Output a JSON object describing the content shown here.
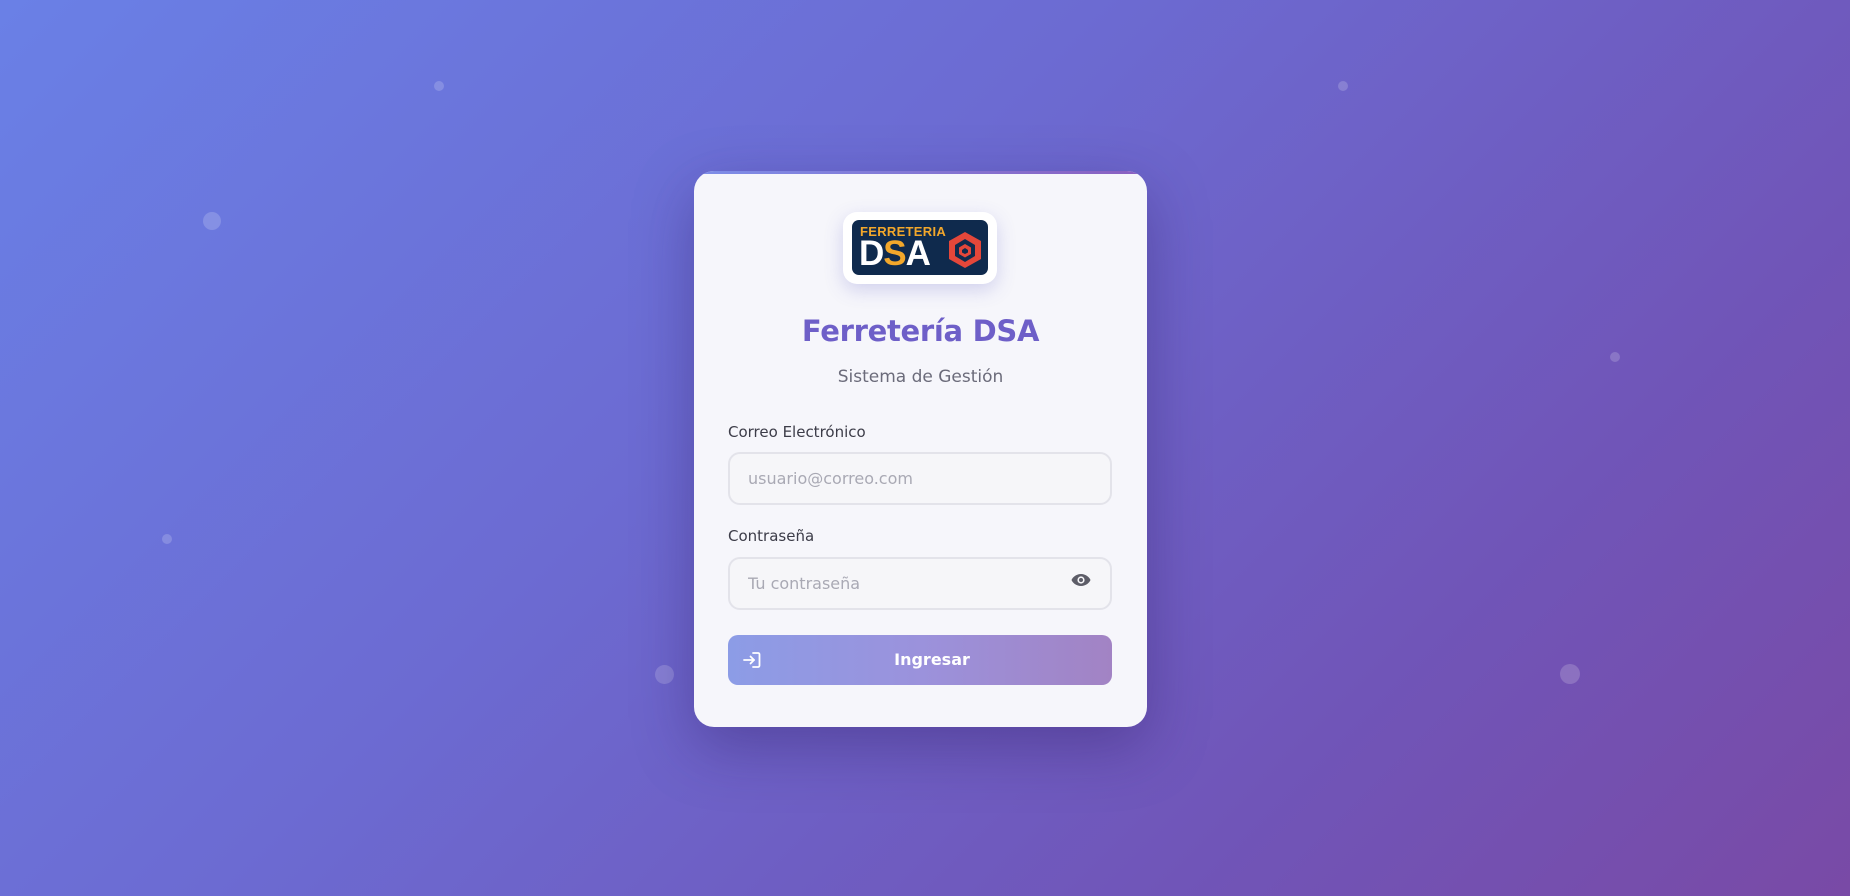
{
  "brand": {
    "logo_top": "FERRETERIA",
    "logo_main_d": "D",
    "logo_main_s": "S",
    "logo_main_a": "A",
    "title": "Ferretería DSA",
    "subtitle": "Sistema de Gestión"
  },
  "form": {
    "email": {
      "label": "Correo Electrónico",
      "placeholder": "usuario@correo.com",
      "value": ""
    },
    "password": {
      "label": "Contraseña",
      "placeholder": "Tu contraseña",
      "value": ""
    },
    "submit_label": "Ingresar"
  },
  "icons": {
    "toggle_password": "eye-icon",
    "submit": "login-icon"
  },
  "colors": {
    "accent": "#6e5fc8",
    "logo_bg": "#0f2a4d",
    "logo_orange": "#f2a72b",
    "logo_red": "#e4473a"
  }
}
